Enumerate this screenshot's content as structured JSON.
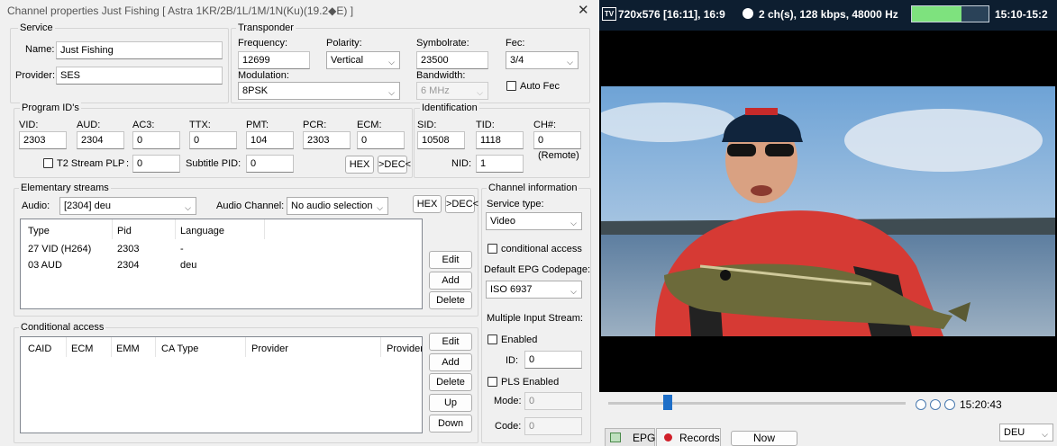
{
  "dialog": {
    "title": "Channel properties Just Fishing [ Astra 1KR/2B/1L/1M/1N(Ku)(19.2◆E) ]",
    "close_glyph": "✕"
  },
  "service": {
    "group_label": "Service",
    "name_label": "Name:",
    "name_value": "Just Fishing",
    "provider_label": "Provider:",
    "provider_value": "SES"
  },
  "transponder": {
    "group_label": "Transponder",
    "frequency_label": "Frequency:",
    "frequency_value": "12699",
    "polarity_label": "Polarity:",
    "polarity_value": "Vertical",
    "symbolrate_label": "Symbolrate:",
    "symbolrate_value": "23500",
    "fec_label": "Fec:",
    "fec_value": "3/4",
    "modulation_label": "Modulation:",
    "modulation_value": "8PSK",
    "bandwidth_label": "Bandwidth:",
    "bandwidth_value": "6 MHz",
    "autofec_label": "Auto Fec"
  },
  "program_ids": {
    "group_label": "Program ID's",
    "vid_label": "VID:",
    "vid_value": "2303",
    "aud_label": "AUD:",
    "aud_value": "2304",
    "ac3_label": "AC3:",
    "ac3_value": "0",
    "ttx_label": "TTX:",
    "ttx_value": "0",
    "pmt_label": "PMT:",
    "pmt_value": "104",
    "pcr_label": "PCR:",
    "pcr_value": "2303",
    "ecm_label": "ECM:",
    "ecm_value": "0",
    "t2_label": "T2 Stream PLP",
    "t2_colon": ":",
    "t2_value": "0",
    "subtitle_label": "Subtitle PID:",
    "subtitle_value": "0",
    "hex_label": "HEX",
    "dec_label": ">DEC<"
  },
  "identification": {
    "group_label": "Identification",
    "sid_label": "SID:",
    "sid_value": "10508",
    "tid_label": "TID:",
    "tid_value": "1118",
    "ch_label": "CH#:",
    "ch_value": "0",
    "remote_label": "(Remote)",
    "nid_label": "NID:",
    "nid_value": "1"
  },
  "elementary": {
    "group_label": "Elementary streams",
    "audio_label": "Audio:",
    "audio_value": "[2304] deu",
    "audio_channel_label": "Audio Channel:",
    "audio_channel_value": "No audio selection",
    "hex_label": "HEX",
    "dec_label": ">DEC<",
    "columns": [
      "Type",
      "Pid",
      "Language"
    ],
    "rows": [
      {
        "type": "27 VID (H264)",
        "pid": "2303",
        "language": "-"
      },
      {
        "type": "03 AUD",
        "pid": "2304",
        "language": "deu"
      }
    ],
    "edit_label": "Edit",
    "add_label": "Add",
    "delete_label": "Delete"
  },
  "conditional": {
    "group_label": "Conditional access",
    "columns": [
      "CAID",
      "ECM",
      "EMM",
      "CA Type",
      "Provider",
      "Provider"
    ],
    "edit_label": "Edit",
    "add_label": "Add",
    "delete_label": "Delete",
    "up_label": "Up",
    "down_label": "Down"
  },
  "channel_info": {
    "group_label": "Channel information",
    "service_type_label": "Service type:",
    "service_type_value": "Video",
    "conditional_access_label": "conditional access",
    "epg_codepage_label": "Default EPG Codepage:",
    "epg_codepage_value": "ISO 6937",
    "multiple_input_label": "Multiple Input Stream:",
    "enabled_label": "Enabled",
    "id_label": "ID:",
    "id_value": "0",
    "pls_label": "PLS Enabled",
    "mode_label": "Mode:",
    "mode_value": "0",
    "code_label": "Code:",
    "code_value": "0"
  },
  "player": {
    "tv_badge": "TV",
    "resolution": "720x576 [16:11], 16:9",
    "audio_info": "2 ch(s), 128 kbps, 48000 Hz",
    "signal_level": 0.65,
    "time_range": "15:10-15:2",
    "clock": "15:20:43",
    "position_fraction": 0.2,
    "epg_tab": "EPG",
    "records_tab": "Records",
    "now_button": "Now",
    "language_value": "DEU",
    "colors": {
      "topbar": "#0d1e30",
      "signal": "#7ee27e",
      "record": "#d0202a",
      "slider": "#1e6fc8"
    }
  }
}
